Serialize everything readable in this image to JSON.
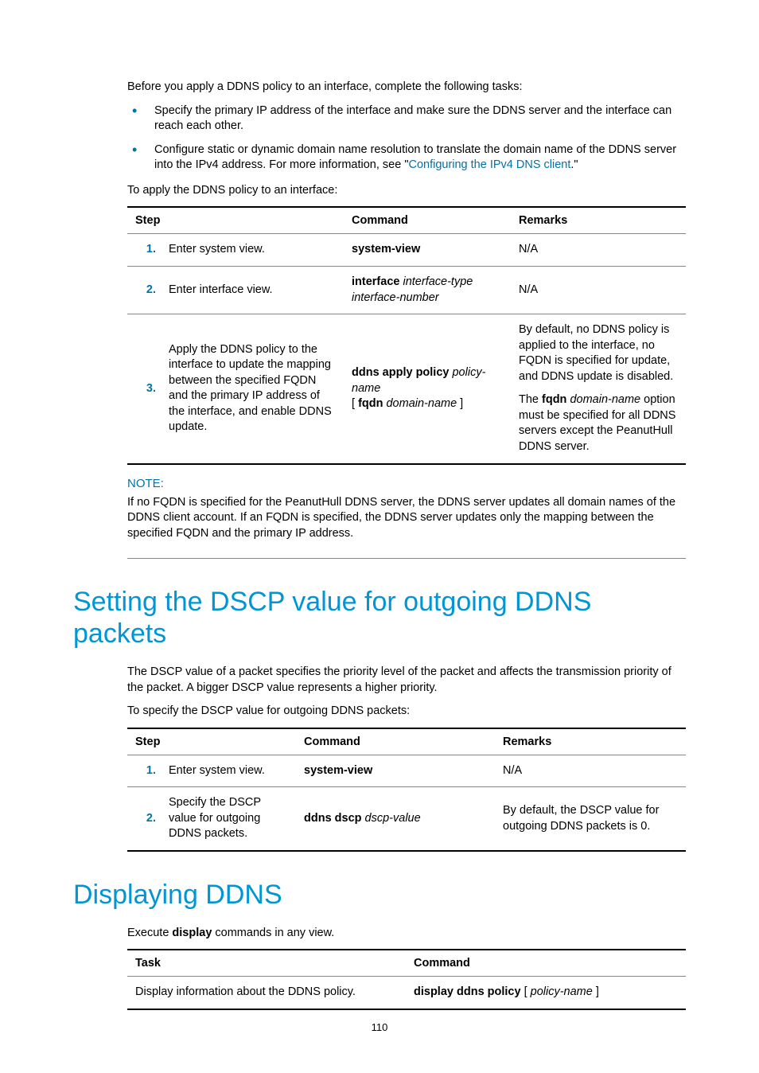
{
  "intro": {
    "para1": "Before you apply a DDNS policy to an interface, complete the following tasks:",
    "bullet1": "Specify the primary IP address of the interface and make sure the DDNS server and the interface can reach each other.",
    "bullet2_a": "Configure static or dynamic domain name resolution to translate the domain name of the DDNS server into the IPv4 address. For more information, see \"",
    "bullet2_link": "Configuring the IPv4 DNS client",
    "bullet2_b": ".\"",
    "para2": "To apply the DDNS policy to an interface:"
  },
  "table1": {
    "headers": {
      "step": "Step",
      "command": "Command",
      "remarks": "Remarks"
    },
    "rows": [
      {
        "num": "1.",
        "desc": "Enter system view.",
        "cmd_bold": "system-view",
        "remarks": "N/A"
      },
      {
        "num": "2.",
        "desc": "Enter interface view.",
        "cmd_bold": "interface",
        "cmd_ital1": " interface-type interface-number",
        "remarks": "N/A"
      },
      {
        "num": "3.",
        "desc": "Apply the DDNS policy to the interface to update the mapping between the specified FQDN and the primary IP address of the interface, and enable DDNS update.",
        "cmd_b1": "ddns apply policy",
        "cmd_i1": " policy-name",
        "cmd_t1": " [ ",
        "cmd_b2": "fqdn",
        "cmd_i2": " domain-name",
        "cmd_t2": " ]",
        "remarks_p1": "By default, no DDNS policy is applied to the interface, no FQDN is specified for update, and DDNS update is disabled.",
        "remarks_p2a": "The ",
        "remarks_p2b": "fqdn",
        "remarks_p2c": " domain-name",
        "remarks_p2d": " option must be specified for all DDNS servers except the PeanutHull DDNS server."
      }
    ]
  },
  "note": {
    "label": "NOTE:",
    "text": "If no FQDN is specified for the PeanutHull DDNS server, the DDNS server updates all domain names of the DDNS client account. If an FQDN is specified, the DDNS server updates only the mapping between the specified FQDN and the primary IP address."
  },
  "section2": {
    "heading": "Setting the DSCP value for outgoing DDNS packets",
    "para1": "The DSCP value of a packet specifies the priority level of the packet and affects the transmission priority of the packet. A bigger DSCP value represents a higher priority.",
    "para2": "To specify the DSCP value for outgoing DDNS packets:"
  },
  "table2": {
    "headers": {
      "step": "Step",
      "command": "Command",
      "remarks": "Remarks"
    },
    "rows": [
      {
        "num": "1.",
        "desc": "Enter system view.",
        "cmd_bold": "system-view",
        "remarks": "N/A"
      },
      {
        "num": "2.",
        "desc": "Specify the DSCP value for outgoing DDNS packets.",
        "cmd_bold": "ddns dscp",
        "cmd_ital": " dscp-value",
        "remarks": "By default, the DSCP value for outgoing DDNS packets is 0."
      }
    ]
  },
  "section3": {
    "heading": "Displaying DDNS",
    "para_a": "Execute ",
    "para_b": "display",
    "para_c": " commands in any view."
  },
  "table3": {
    "headers": {
      "task": "Task",
      "command": "Command"
    },
    "row": {
      "task": "Display information about the DDNS policy.",
      "cmd_b": "display ddns policy",
      "cmd_t1": " [ ",
      "cmd_i": "policy-name",
      "cmd_t2": " ]"
    }
  },
  "pageno": "110"
}
